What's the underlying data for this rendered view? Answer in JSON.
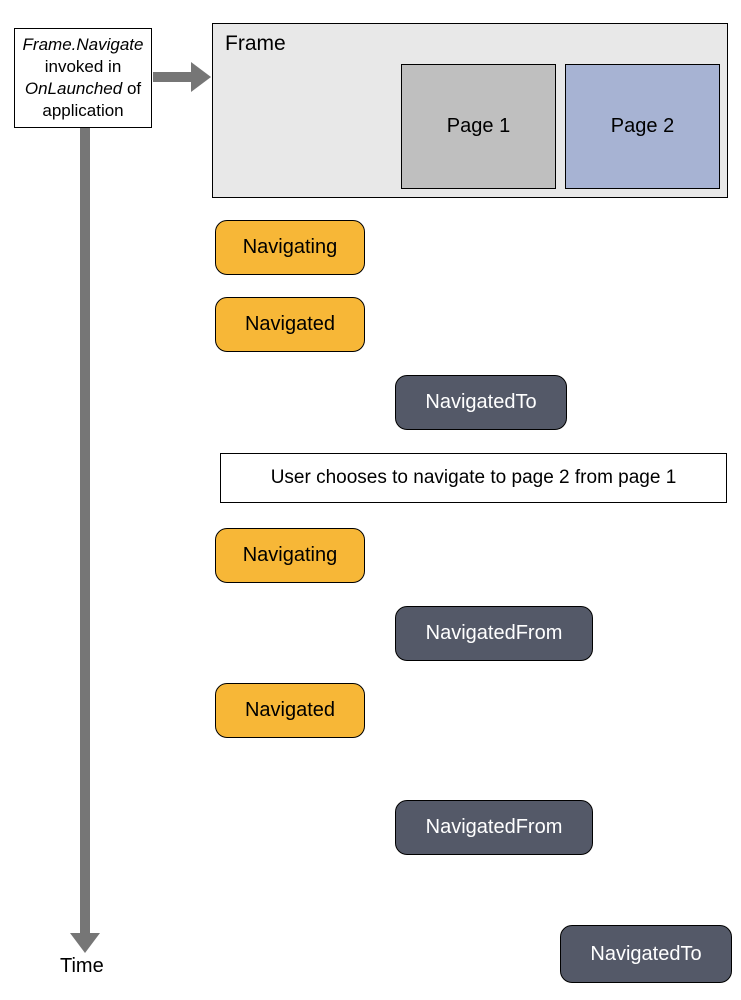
{
  "invoke": {
    "prefix": "Frame.Navigate",
    "mid": " invoked in ",
    "method": "OnLaunched",
    "suffix": " of application"
  },
  "frame": {
    "label": "Frame",
    "page1": "Page 1",
    "page2": "Page 2"
  },
  "events": {
    "nav1": "Navigating",
    "nav2": "Navigated",
    "navto1": "NavigatedTo",
    "user_action": "User chooses to navigate to page 2 from page 1",
    "nav3": "Navigating",
    "navfrom1": "NavigatedFrom",
    "nav4": "Navigated",
    "navfrom2": "NavigatedFrom",
    "navto2": "NavigatedTo"
  },
  "time_label": "Time"
}
